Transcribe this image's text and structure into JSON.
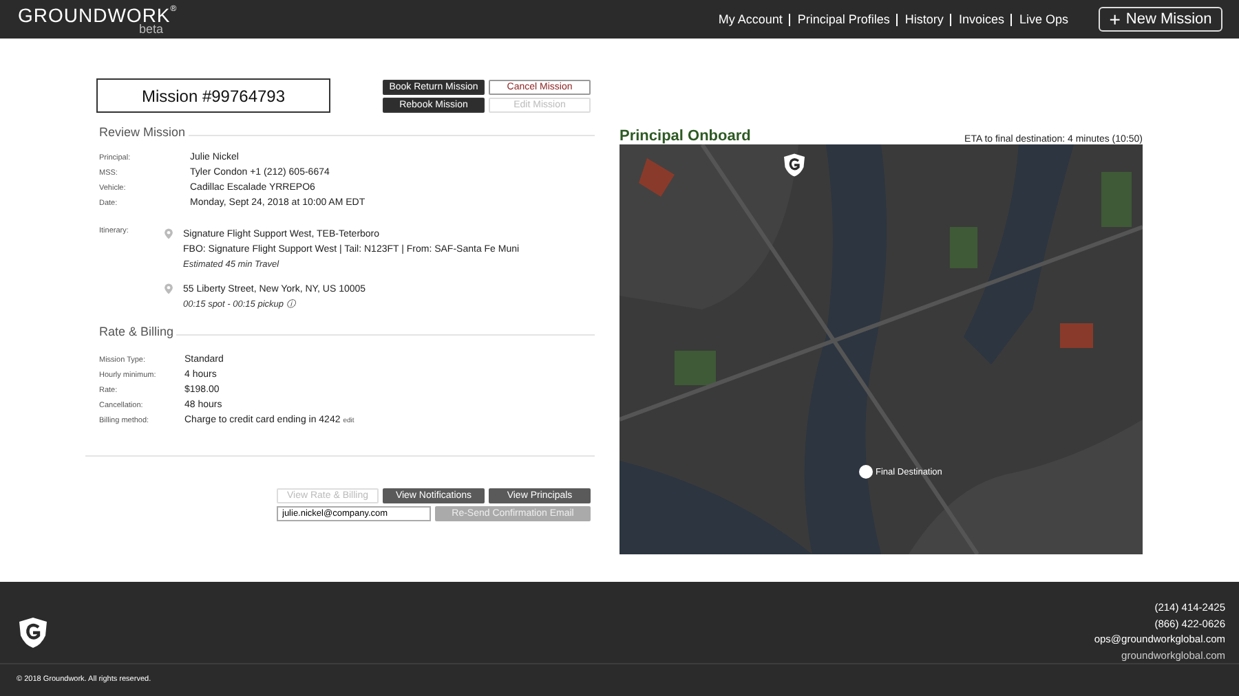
{
  "header": {
    "brand": "GROUNDWORK",
    "brand_mark": "®",
    "brand_sub": "beta",
    "nav": [
      {
        "label": "My Account"
      },
      {
        "label": "Principal Profiles"
      },
      {
        "label": "History"
      },
      {
        "label": "Invoices"
      },
      {
        "label": "Live Ops"
      }
    ],
    "new_button": {
      "icon": "+",
      "label": "New Mission"
    }
  },
  "mission": {
    "title": "Mission #99764793",
    "actions": [
      {
        "label": "Book Return Mission",
        "kind": "dark"
      },
      {
        "label": "Cancel Mission",
        "kind": "danger"
      },
      {
        "label": "Rebook Mission",
        "kind": "dark"
      },
      {
        "label": "Edit Mission",
        "kind": "disabled"
      }
    ]
  },
  "review": {
    "heading": "Review Mission",
    "fields": [
      {
        "label": "Principal:",
        "value": "Julie Nickel"
      },
      {
        "label": "MSS:",
        "value": "Tyler Condon +1 (212) 605-6674"
      },
      {
        "label": "Vehicle:",
        "value": "Cadillac Escalade YRREPO6"
      },
      {
        "label": "Date:",
        "value": "Monday, Sept 24, 2018 at 10:00 AM EDT"
      }
    ],
    "itinerary_label": "Itinerary:",
    "stops": [
      {
        "title": "Signature Flight Support West, TEB-Teterboro",
        "detail": "FBO: Signature Flight Support West | Tail: N123FT | From: SAF-Santa Fe Muni",
        "note": "Estimated 45 min Travel"
      },
      {
        "title": "55 Liberty Street, New York, NY, US 10005",
        "note": "00:15 spot - 00:15 pickup ⓘ"
      }
    ]
  },
  "billing": {
    "heading": "Rate & Billing",
    "fields": [
      {
        "label": "Mission Type:",
        "value": "Standard"
      },
      {
        "label": "Hourly minimum:",
        "value": "4 hours"
      },
      {
        "label": "Rate:",
        "value": "$198.00"
      },
      {
        "label": "Cancellation:",
        "value": "48 hours"
      },
      {
        "label": "Billing method:",
        "value": "Charge to credit card ending in 4242",
        "link": "edit"
      }
    ]
  },
  "bottom_actions": [
    {
      "label": "View Rate & Billing",
      "kind": "disabled"
    },
    {
      "label": "View Notifications",
      "kind": "grey"
    },
    {
      "label": "View Principals",
      "kind": "grey"
    }
  ],
  "email": {
    "value": "julie.nickel@company.com",
    "button": {
      "label": "Re-Send Confirmation Email",
      "kind": "muted"
    }
  },
  "map_panel": {
    "title": "Principal Onboard",
    "eta": "ETA to final destination: 4 minutes (10:50)",
    "destination_label": "Final Destination"
  },
  "footer": {
    "contacts": [
      "(214) 414-2425",
      "(866) 422-0626",
      "ops@groundworkglobal.com"
    ],
    "website": "groundworkglobal.com",
    "copyright": "© 2018 Groundwork. All rights reserved."
  }
}
